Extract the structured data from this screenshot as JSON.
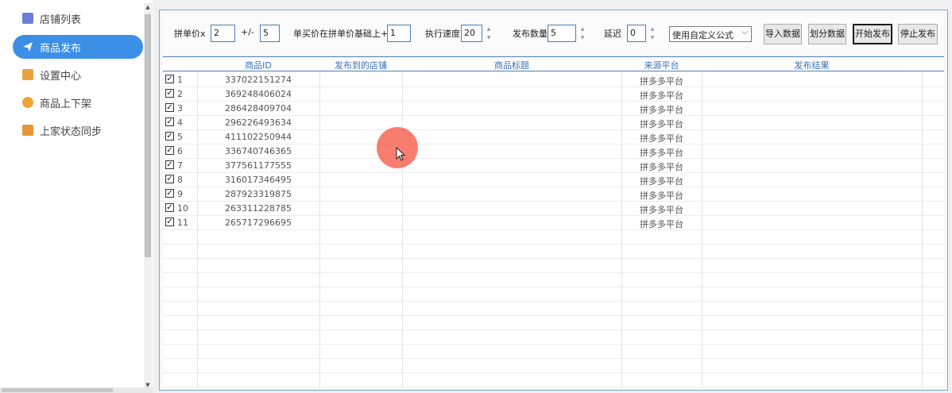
{
  "sidebar": {
    "items": [
      {
        "label": "店铺列表",
        "icon": "store-list-icon",
        "color": "#6a7fdb",
        "active": false
      },
      {
        "label": "商品发布",
        "icon": "paper-plane-icon",
        "color": "#ffffff",
        "active": true
      },
      {
        "label": "设置中心",
        "icon": "settings-box-icon",
        "color": "#e8a33c",
        "active": false
      },
      {
        "label": "商品上下架",
        "icon": "shelf-tag-icon",
        "color": "#f0a43a",
        "active": false
      },
      {
        "label": "上家状态同步",
        "icon": "sync-doc-icon",
        "color": "#e8953a",
        "active": false
      }
    ]
  },
  "toolbar": {
    "price_multiplier_label": "拼单价x",
    "price_multiplier_value": "2",
    "plus_minus_label": "+/-",
    "plus_minus_value": "5",
    "buy_price_label": "单买价在拼单价基础上+",
    "buy_price_value": "1",
    "speed_label": "执行速度",
    "speed_value": "20",
    "publish_count_label": "发布数量",
    "publish_count_value": "5",
    "delay_label": "延迟",
    "delay_value": "0",
    "formula_select": "使用自定义公式",
    "import_button": "导入数据",
    "split_button": "划分数据",
    "start_button": "开始发布",
    "stop_button": "停止发布"
  },
  "table": {
    "columns": [
      "商品ID",
      "发布到的店铺",
      "商品标题",
      "来源平台",
      "发布结果"
    ],
    "rows": [
      {
        "num": "1",
        "id": "337022151274",
        "shop": "",
        "title": "",
        "platform": "拼多多平台",
        "result": "",
        "checked": true
      },
      {
        "num": "2",
        "id": "369248406024",
        "shop": "",
        "title": "",
        "platform": "拼多多平台",
        "result": "",
        "checked": true
      },
      {
        "num": "3",
        "id": "286428409704",
        "shop": "",
        "title": "",
        "platform": "拼多多平台",
        "result": "",
        "checked": true
      },
      {
        "num": "4",
        "id": "296226493634",
        "shop": "",
        "title": "",
        "platform": "拼多多平台",
        "result": "",
        "checked": true
      },
      {
        "num": "5",
        "id": "411102250944",
        "shop": "",
        "title": "",
        "platform": "拼多多平台",
        "result": "",
        "checked": true
      },
      {
        "num": "6",
        "id": "336740746365",
        "shop": "",
        "title": "",
        "platform": "拼多多平台",
        "result": "",
        "checked": true
      },
      {
        "num": "7",
        "id": "377561177555",
        "shop": "",
        "title": "",
        "platform": "拼多多平台",
        "result": "",
        "checked": true
      },
      {
        "num": "8",
        "id": "316017346495",
        "shop": "",
        "title": "",
        "platform": "拼多多平台",
        "result": "",
        "checked": true
      },
      {
        "num": "9",
        "id": "287923319875",
        "shop": "",
        "title": "",
        "platform": "拼多多平台",
        "result": "",
        "checked": true
      },
      {
        "num": "10",
        "id": "263311228785",
        "shop": "",
        "title": "",
        "platform": "拼多多平台",
        "result": "",
        "checked": true
      },
      {
        "num": "11",
        "id": "265717296695",
        "shop": "",
        "title": "",
        "platform": "拼多多平台",
        "result": "",
        "checked": true
      }
    ]
  },
  "colors": {
    "accent": "#3b8fe6",
    "header_text": "#3b6fb6",
    "cursor_highlight": "#f55a46"
  }
}
